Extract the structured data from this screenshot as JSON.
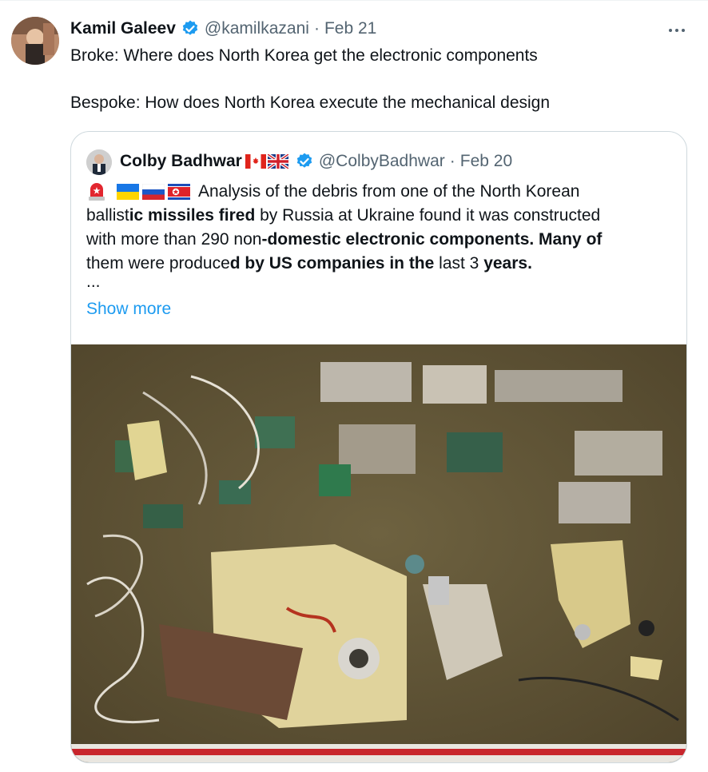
{
  "tweet": {
    "author_name": "Kamil Galeev",
    "author_handle": "@kamilkazani",
    "separator": "·",
    "date": "Feb 21",
    "lines": [
      "Broke: Where does North Korea get the electronic components",
      "Bespoke: How does North Korea execute the mechanical design"
    ],
    "icons": {
      "verified": "verified-badge-icon",
      "more": "more-options-icon"
    }
  },
  "quote": {
    "author_name": "Colby Badhwar",
    "author_handle": "@ColbyBadhwar",
    "separator": "·",
    "date": "Feb 20",
    "flags": [
      "canada-flag",
      "uk-flag"
    ],
    "emojis": [
      "siren-icon",
      "ukraine-flag",
      "russia-flag",
      "north-korea-flag"
    ],
    "text": {
      "l1": "Analysis of the debris from one of the North Korean",
      "l2a": "ballist",
      "l2b": "ic missiles fired",
      "l2c": " by Russia at Ukraine found it was constructed",
      "l3a": "with more than 290 non",
      "l3b": "-domestic electronic components. Many of",
      "l4a": "them were produce",
      "l4b": "d by US companies in the",
      "l4c": " last 3 ",
      "l4d": "years.",
      "ellipsis": "..."
    },
    "show_more": "Show more",
    "media_alt": "photo-of-missile-debris"
  },
  "colors": {
    "link": "#1d9bf0",
    "verified": "#1d9bf0",
    "secondary_text": "#536471",
    "border": "#cfd9de"
  }
}
